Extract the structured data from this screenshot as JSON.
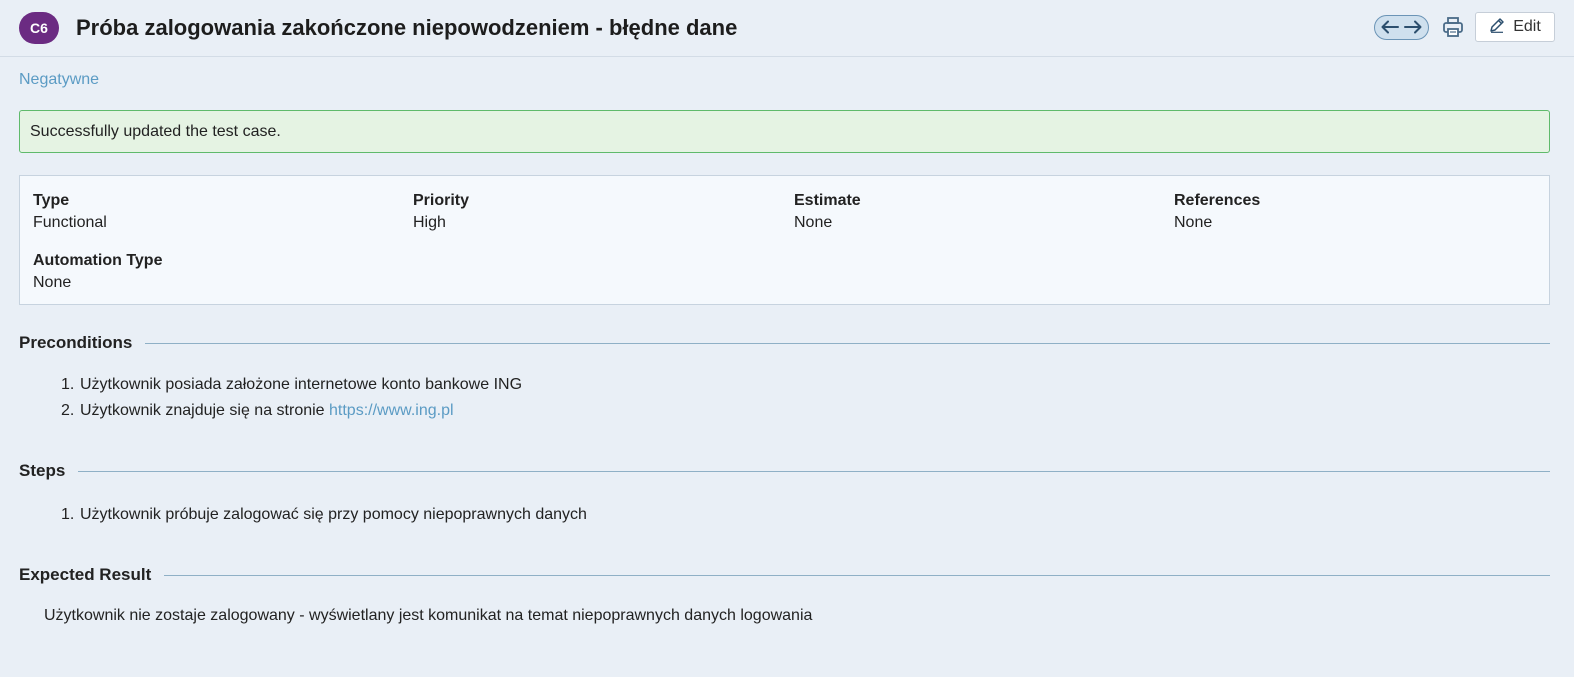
{
  "header": {
    "case_id": "C6",
    "title": "Próba zalogowania zakończone niepowodzeniem - błędne dane",
    "edit_label": "Edit",
    "icons": {
      "prev": "arrow-left-icon",
      "next": "arrow-right-icon",
      "print": "printer-icon",
      "edit": "pencil-icon"
    }
  },
  "section_link": "Negatywne",
  "alert": {
    "message": "Successfully updated the test case.",
    "color": "#e5f3e3"
  },
  "fields": {
    "type": {
      "label": "Type",
      "value": "Functional"
    },
    "priority": {
      "label": "Priority",
      "value": "High"
    },
    "estimate": {
      "label": "Estimate",
      "value": "None"
    },
    "references": {
      "label": "References",
      "value": "None"
    },
    "automation_type": {
      "label": "Automation Type",
      "value": "None"
    }
  },
  "preconditions": {
    "heading": "Preconditions",
    "items": [
      {
        "num": "1.",
        "text": "Użytkownik posiada założone internetowe konto bankowe ING"
      },
      {
        "num": "2.",
        "text": "Użytkownik znajduje się na stronie ",
        "link": "https://www.ing.pl"
      }
    ]
  },
  "steps": {
    "heading": "Steps",
    "items": [
      {
        "num": "1.",
        "text": "Użytkownik próbuje zalogować się przy pomocy niepoprawnych danych"
      }
    ]
  },
  "expected_result": {
    "heading": "Expected Result",
    "text": "Użytkownik nie zostaje zalogowany - wyświetlany jest komunikat na temat niepoprawnych danych logowania"
  },
  "colors": {
    "badge": "#6b2b82",
    "link": "#5b9bc4",
    "background": "#e9eff6"
  }
}
